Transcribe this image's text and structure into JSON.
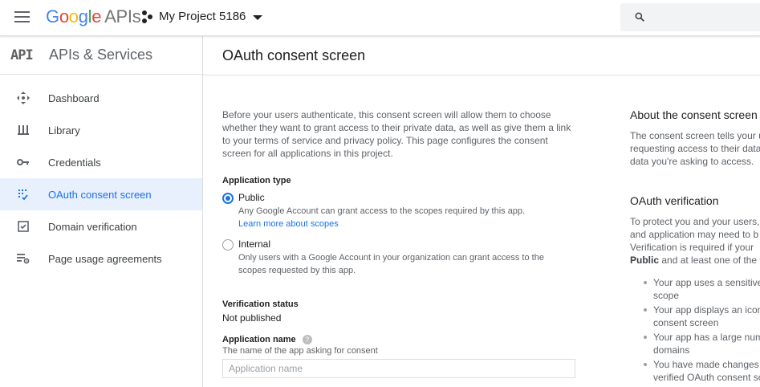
{
  "topbar": {
    "logo_letters": [
      "G",
      "o",
      "o",
      "g",
      "l",
      "e"
    ],
    "logo_suffix": "APIs",
    "project_name": "My Project 5186",
    "search_placeholder": ""
  },
  "sidebar": {
    "badge": "API",
    "title": "APIs & Services",
    "items": [
      {
        "label": "Dashboard",
        "icon": "dashboard-icon",
        "active": false
      },
      {
        "label": "Library",
        "icon": "library-icon",
        "active": false
      },
      {
        "label": "Credentials",
        "icon": "key-icon",
        "active": false
      },
      {
        "label": "OAuth consent screen",
        "icon": "consent-icon",
        "active": true
      },
      {
        "label": "Domain verification",
        "icon": "checkbox-icon",
        "active": false
      },
      {
        "label": "Page usage agreements",
        "icon": "settings-list-icon",
        "active": false
      }
    ]
  },
  "main": {
    "title": "OAuth consent screen",
    "intro_lines": [
      "Before your users authenticate, this consent screen will allow them to choose",
      "whether they want to grant access to their private data, as well as give them a link",
      "to your terms of service and privacy policy. This page configures the consent",
      "screen for all applications in this project."
    ],
    "app_type_label": "Application type",
    "public": {
      "title": "Public",
      "desc": "Any Google Account can grant access to the scopes required by this app.",
      "link": "Learn more about scopes",
      "selected": true
    },
    "internal": {
      "title": "Internal",
      "desc_lines": [
        "Only users with a Google Account in your organization can grant access to the",
        "scopes requested by this app."
      ],
      "selected": false
    },
    "verification_status_label": "Verification status",
    "verification_status_value": "Not published",
    "app_name_label": "Application name",
    "app_name_help": "?",
    "app_name_desc": "The name of the app asking for consent",
    "app_name_placeholder": "Application name",
    "app_name_value": ""
  },
  "right": {
    "about_title": "About the consent screen",
    "about_lines": [
      "The consent screen tells your u",
      "requesting access to their data",
      "data you're asking to access."
    ],
    "verify_title": "OAuth verification",
    "verify_lines": [
      "To protect you and your users,",
      "and application may need to b",
      "Verification is required if your"
    ],
    "verify_line4_bold": "Public",
    "verify_line4_rest": " and at least one of the f",
    "bullets": [
      [
        "Your app uses a sensitive",
        "scope"
      ],
      [
        "Your app displays an icon",
        "consent screen"
      ],
      [
        "Your app has a large num",
        "domains"
      ],
      [
        "You have made changes t",
        "verified OAuth consent sc"
      ]
    ]
  }
}
